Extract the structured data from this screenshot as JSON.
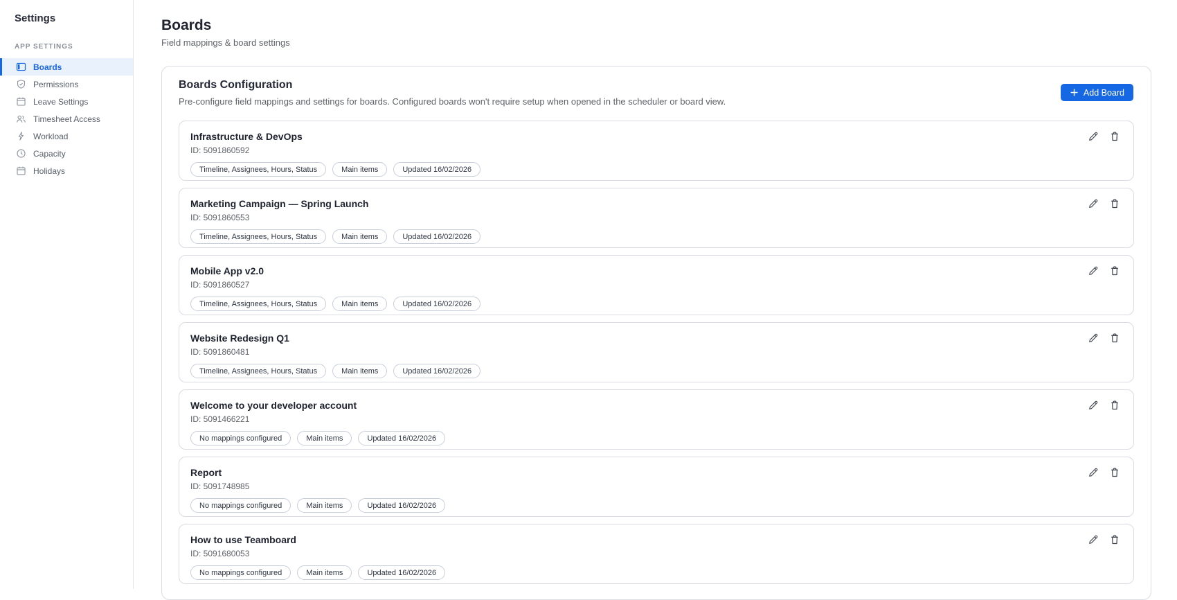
{
  "colors": {
    "accent": "#1667E3",
    "accent_soft": "#E9F1FD",
    "border": "#D9DCE2",
    "text_dark": "#1F2430",
    "text_gray": "#5F6368"
  },
  "sidebar": {
    "title": "Settings",
    "section_label": "APP SETTINGS",
    "items": [
      {
        "label": "Boards",
        "icon": "board-icon",
        "selected": true
      },
      {
        "label": "Permissions",
        "icon": "shield-icon",
        "selected": false
      },
      {
        "label": "Leave Settings",
        "icon": "calendar-icon",
        "selected": false
      },
      {
        "label": "Timesheet Access",
        "icon": "people-icon",
        "selected": false
      },
      {
        "label": "Workload",
        "icon": "bolt-icon",
        "selected": false
      },
      {
        "label": "Capacity",
        "icon": "clock-icon",
        "selected": false
      },
      {
        "label": "Holidays",
        "icon": "calendar-icon",
        "selected": false
      }
    ]
  },
  "header": {
    "title": "Boards",
    "subtitle": "Field mappings & board settings"
  },
  "panel": {
    "title": "Boards Configuration",
    "description": "Pre-configure field mappings and settings for boards. Configured boards won't require setup when opened in the scheduler or board view.",
    "add_button_label": "Add Board"
  },
  "boards": [
    {
      "name": "Infrastructure & DevOps",
      "id_label": "ID: 5091860592",
      "tags": [
        "Timeline, Assignees, Hours, Status",
        "Main items",
        "Updated 16/02/2026"
      ]
    },
    {
      "name": "Marketing Campaign — Spring Launch",
      "id_label": "ID: 5091860553",
      "tags": [
        "Timeline, Assignees, Hours, Status",
        "Main items",
        "Updated 16/02/2026"
      ]
    },
    {
      "name": "Mobile App v2.0",
      "id_label": "ID: 5091860527",
      "tags": [
        "Timeline, Assignees, Hours, Status",
        "Main items",
        "Updated 16/02/2026"
      ]
    },
    {
      "name": "Website Redesign Q1",
      "id_label": "ID: 5091860481",
      "tags": [
        "Timeline, Assignees, Hours, Status",
        "Main items",
        "Updated 16/02/2026"
      ]
    },
    {
      "name": "Welcome to your developer account",
      "id_label": "ID: 5091466221",
      "tags": [
        "No mappings configured",
        "Main items",
        "Updated 16/02/2026"
      ]
    },
    {
      "name": "Report",
      "id_label": "ID: 5091748985",
      "tags": [
        "No mappings configured",
        "Main items",
        "Updated 16/02/2026"
      ]
    },
    {
      "name": "How to use Teamboard",
      "id_label": "ID: 5091680053",
      "tags": [
        "No mappings configured",
        "Main items",
        "Updated 16/02/2026"
      ]
    }
  ]
}
